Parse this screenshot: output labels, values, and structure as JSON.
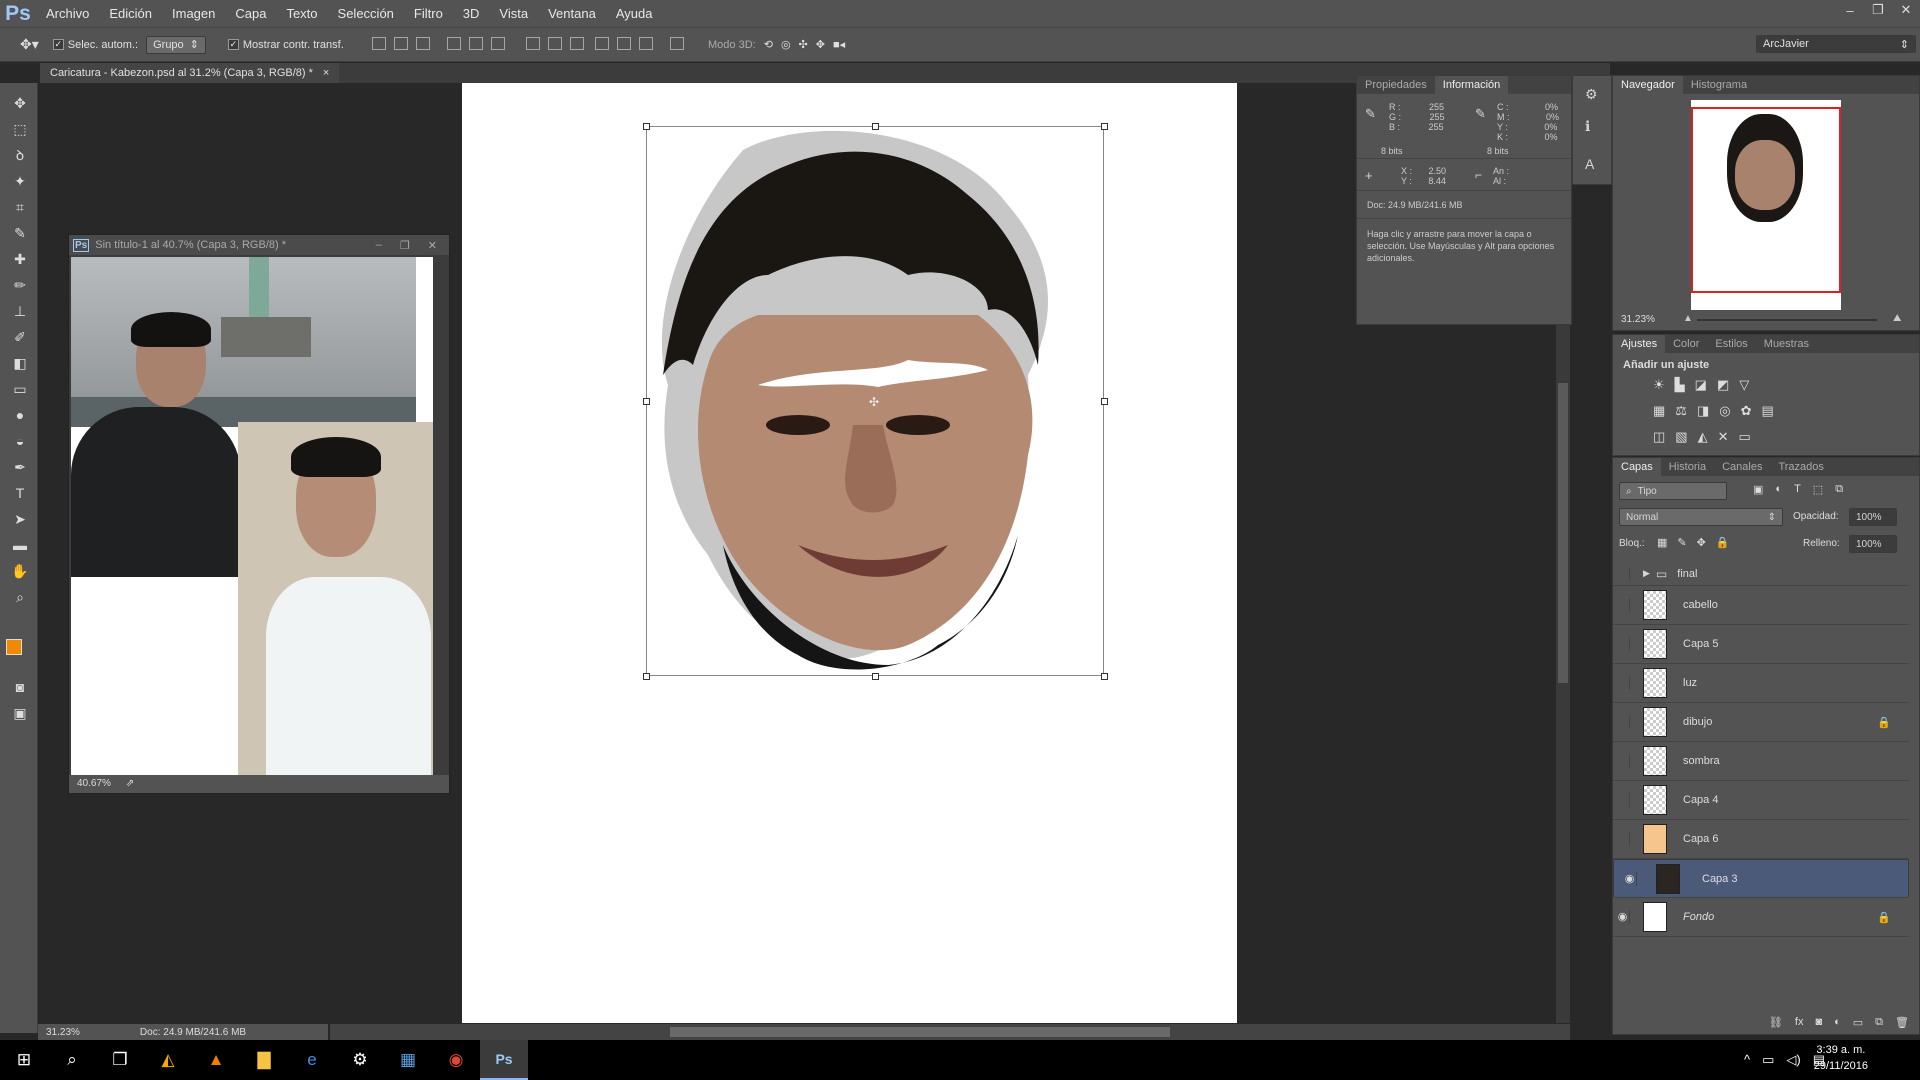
{
  "app": {
    "logo": "Ps"
  },
  "menu": [
    "Archivo",
    "Edición",
    "Imagen",
    "Capa",
    "Texto",
    "Selección",
    "Filtro",
    "3D",
    "Vista",
    "Ventana",
    "Ayuda"
  ],
  "window_controls": [
    "–",
    "❐",
    "✕"
  ],
  "options": {
    "auto_select_label": "Selec. autom.:",
    "auto_select_value": "Grupo",
    "show_transform_label": "Mostrar contr. transf.",
    "mode3d_label": "Modo 3D:",
    "workspace": "ArcJavier"
  },
  "document_tab": {
    "title": "Caricatura - Kabezon.psd al 31.2% (Capa 3, RGB/8) *",
    "close": "×"
  },
  "float_window": {
    "title": "Sin título-1 al 40.7% (Capa 3, RGB/8) *",
    "zoom": "40.67%"
  },
  "status": {
    "zoom": "31.23%",
    "doc": "Doc: 24.9 MB/241.6 MB"
  },
  "info_panel": {
    "tabs": [
      "Propiedades",
      "Información"
    ],
    "active_tab": "Información",
    "rgb_labels": [
      "R :",
      "G :",
      "B :"
    ],
    "rgb_values": [
      "255",
      "255",
      "255"
    ],
    "cmyk_labels": [
      "C :",
      "M :",
      "Y :",
      "K :"
    ],
    "cmyk_values": [
      "0%",
      "0%",
      "0%",
      "0%"
    ],
    "bits_left": "8 bits",
    "bits_right": "8 bits",
    "x_label": "X :",
    "x_value": "2.50",
    "y_label": "Y :",
    "y_value": "8.44",
    "w_label": "An :",
    "h_label": "Al :",
    "doc": "Doc: 24.9 MB/241.6 MB",
    "hint": "Haga clic y arrastre para mover la capa o selección. Use Mayúsculas y Alt para opciones adicionales."
  },
  "navigator": {
    "tabs": [
      "Navegador",
      "Histograma"
    ],
    "zoom": "31.23%"
  },
  "adjustments": {
    "tabs": [
      "Ajustes",
      "Color",
      "Estilos",
      "Muestras"
    ],
    "heading": "Añadir un ajuste"
  },
  "layers_panel": {
    "tabs": [
      "Capas",
      "Historia",
      "Canales",
      "Trazados"
    ],
    "filter": "Tipo",
    "blend_mode": "Normal",
    "opacity_label": "Opacidad:",
    "opacity": "100%",
    "lock_label": "Bloq.:",
    "fill_label": "Relleno:",
    "fill": "100%",
    "group": "final",
    "layers": [
      {
        "name": "cabello",
        "visible": false,
        "locked": false,
        "selected": false
      },
      {
        "name": "Capa 5",
        "visible": false,
        "locked": false,
        "selected": false
      },
      {
        "name": "luz",
        "visible": false,
        "locked": false,
        "selected": false
      },
      {
        "name": "dibujo",
        "visible": false,
        "locked": true,
        "selected": false
      },
      {
        "name": "sombra",
        "visible": false,
        "locked": false,
        "selected": false
      },
      {
        "name": "Capa 4",
        "visible": false,
        "locked": false,
        "selected": false
      },
      {
        "name": "Capa 6",
        "visible": false,
        "locked": false,
        "selected": false
      },
      {
        "name": "Capa 3",
        "visible": true,
        "locked": false,
        "selected": true
      },
      {
        "name": "Fondo",
        "visible": true,
        "locked": true,
        "selected": false
      }
    ]
  },
  "clock": {
    "time": "3:39 a. m.",
    "date": "29/11/2016"
  },
  "colors": {
    "foreground": "#f08a00",
    "background": "#000000",
    "accent": "#4c5a7a"
  }
}
